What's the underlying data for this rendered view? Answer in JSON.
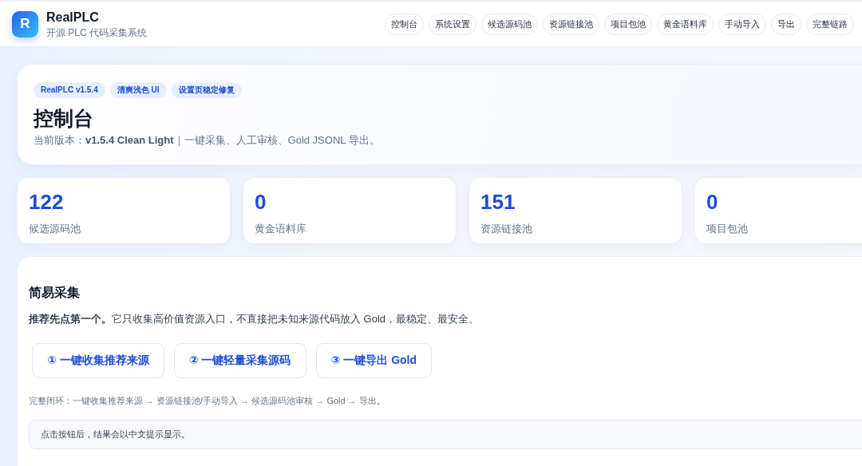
{
  "header": {
    "logo": "R",
    "title": "RealPLC",
    "subtitle": "开源 PLC 代码采集系统",
    "nav": [
      "控制台",
      "系统设置",
      "候选源码池",
      "资源链接池",
      "项目包池",
      "黄金语料库",
      "手动导入",
      "导出",
      "完整链路"
    ]
  },
  "hero": {
    "badges": [
      "RealPLC v1.5.4",
      "清爽浅色 UI",
      "设置页稳定修复"
    ],
    "title": "控制台",
    "subtitle": "当前版本：**v1.5.4 Clean Light**｜一键采集、人工审核、Gold JSONL 导出。"
  },
  "stats": [
    {
      "value": "122",
      "label": "候选源码池"
    },
    {
      "value": "0",
      "label": "黄金语料库"
    },
    {
      "value": "151",
      "label": "资源链接池"
    },
    {
      "value": "0",
      "label": "项目包池"
    }
  ],
  "quick_collect": {
    "title": "简易采集",
    "description": "**推荐先点第一个。**它只收集高价值资源入口，不直接把未知来源代码放入 Gold，最稳定、最安全。",
    "buttons": [
      "① 一键收集推荐来源",
      "② 一键轻量采集源码",
      "③ 一键导出 Gold"
    ],
    "flow": "完整闭环：一键收集推荐来源 → 资源链接池/手动导入 → 候选源码池审核 → Gold → 导出。",
    "result": "点击按钮后，结果会以中文提示显示。"
  }
}
